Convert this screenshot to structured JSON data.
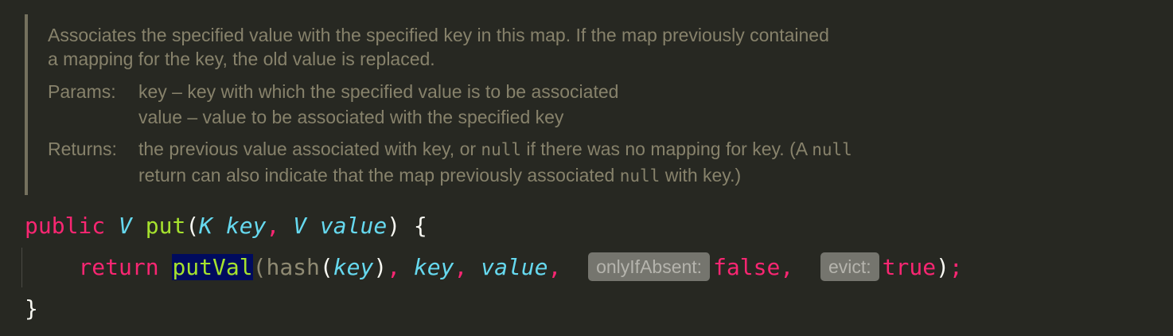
{
  "doc": {
    "desc_line1": "Associates the specified value with the specified key in this map. If the map previously contained",
    "desc_line2": "a mapping for the key, the old value is replaced.",
    "params_label": "Params:",
    "param1": "key – key with which the specified value is to be associated",
    "param2": "value – value to be associated with the specified key",
    "returns_label": "Returns:",
    "returns_line1_a": "the previous value associated with key, or ",
    "returns_null_1": "null",
    "returns_line1_b": " if there was no mapping for key. (A ",
    "returns_null_2": "null",
    "returns_line2_a": "return can also indicate that the map previously associated ",
    "returns_null_3": "null",
    "returns_line2_b": " with key.)"
  },
  "code": {
    "line1": {
      "public": "public",
      "ret_type": "V",
      "method": "put",
      "open_paren": "(",
      "param_type1": "K",
      "param1": "key",
      "comma1": ",",
      "param_type2": "V",
      "param2": "value",
      "close_brace_open": ") {"
    },
    "line2": {
      "return": "return",
      "call": "putVal",
      "open": "(",
      "hash": "hash",
      "hash_open": "(",
      "hash_arg": "key",
      "hash_close": ")",
      "comma1": ",",
      "arg2": "key",
      "comma2": ",",
      "arg3": "value",
      "comma3": ",",
      "hint1": "onlyIfAbsent:",
      "val1": "false",
      "comma4": ",",
      "hint2": "evict:",
      "val2": "true",
      "close": ")",
      "semicolon": ";"
    },
    "line3": {
      "close_brace": "}"
    }
  }
}
